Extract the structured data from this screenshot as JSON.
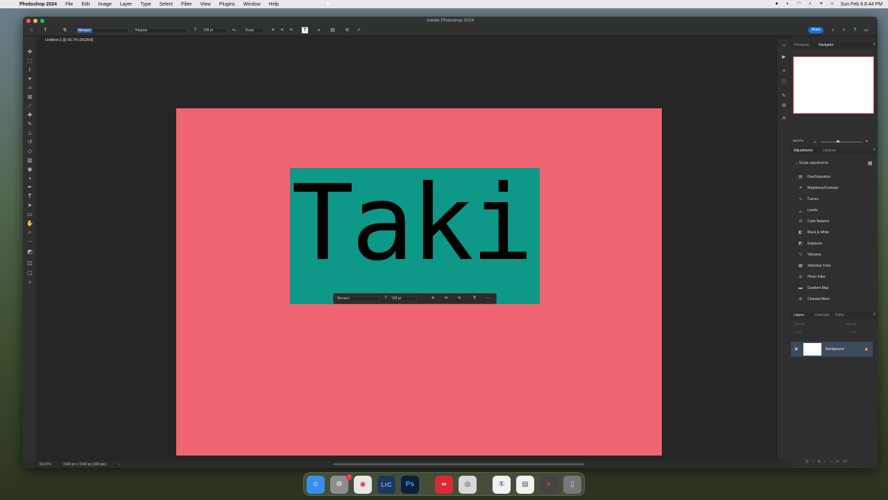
{
  "menubar": {
    "app_name": "Photoshop 2024",
    "items": [
      "File",
      "Edit",
      "Image",
      "Layer",
      "Type",
      "Select",
      "Filter",
      "View",
      "Plugins",
      "Window",
      "Help"
    ],
    "clock": "Sun Feb 8  8:44 PM"
  },
  "window": {
    "title": "Adobe Photoshop 2024"
  },
  "options_bar": {
    "font_family": "Monaco",
    "font_style": "Regular",
    "font_size": "108 pt",
    "antialias_label": "aₐ",
    "antialias": "Sharp",
    "share_label": "Share"
  },
  "document": {
    "tab_title": "Untitled-1 @ 66.7% (RGB/8)",
    "background_color": "#ef6472",
    "text_box_color": "#0e9888",
    "text_content": "Taki"
  },
  "context_bar": {
    "font_family": "Monaco",
    "font_size": "108 pt"
  },
  "status_bar": {
    "zoom": "66.67%",
    "dimensions": "2100 px x 1500 px (300 ppi)"
  },
  "panels": {
    "top_tabs": [
      "Histogram",
      "Navigator"
    ],
    "navigator_zoom": "66.67%",
    "adj_tabs": [
      "Adjustments",
      "Libraries"
    ],
    "adj_section": "Single adjustments",
    "adjustments": [
      {
        "label": "Hue/Saturation",
        "icon": "hue-saturation-icon",
        "glyph": "▤"
      },
      {
        "label": "Brightness/Contrast",
        "icon": "brightness-icon",
        "glyph": "☀"
      },
      {
        "label": "Curves",
        "icon": "curves-icon",
        "glyph": "∿"
      },
      {
        "label": "Levels",
        "icon": "levels-icon",
        "glyph": "▁"
      },
      {
        "label": "Color Balance",
        "icon": "color-balance-icon",
        "glyph": "⚖"
      },
      {
        "label": "Black & White",
        "icon": "black-white-icon",
        "glyph": "◧"
      },
      {
        "label": "Exposure",
        "icon": "exposure-icon",
        "glyph": "◩"
      },
      {
        "label": "Vibrance",
        "icon": "vibrance-icon",
        "glyph": "▽"
      },
      {
        "label": "Selective Color",
        "icon": "selective-color-icon",
        "glyph": "▦"
      },
      {
        "label": "Photo Filter",
        "icon": "photo-filter-icon",
        "glyph": "◎"
      },
      {
        "label": "Gradient Map",
        "icon": "gradient-map-icon",
        "glyph": "▬"
      },
      {
        "label": "Channel Mixer",
        "icon": "channel-mixer-icon",
        "glyph": "⊚"
      }
    ],
    "layer_tabs": [
      "Layers",
      "Channels",
      "Paths"
    ],
    "layer_blend": "Normal",
    "layer_opacity_label": "Opacity:",
    "layer_lock_label": "Lock:",
    "layer_fill_label": "Fill:",
    "layer_name": "Background"
  },
  "colors": {
    "accent": "#1473e6"
  }
}
